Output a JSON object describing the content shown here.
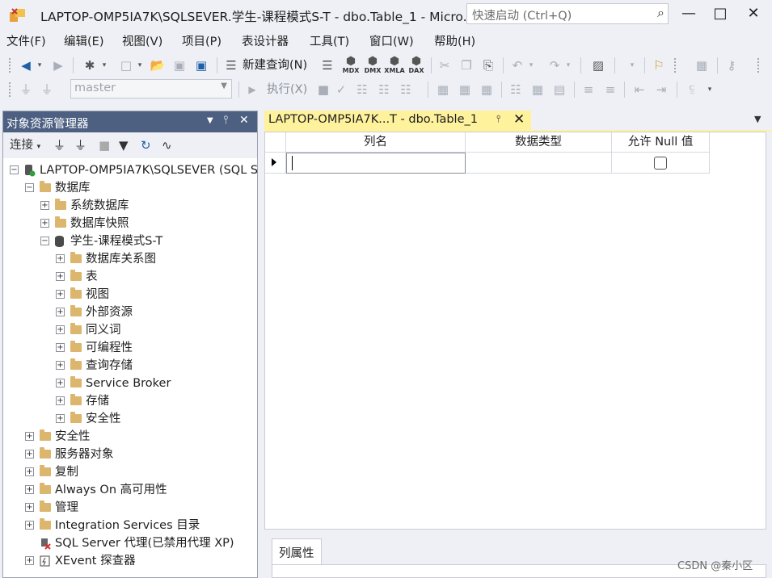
{
  "window": {
    "title": "LAPTOP-OMP5IA7K\\SQLSEVER.学生-课程模式S-T - dbo.Table_1 - Micro...",
    "quick_launch_placeholder": "快速启动 (Ctrl+Q)",
    "minimize": "—",
    "maximize": "□",
    "close": "✕"
  },
  "menu": [
    "文件(F)",
    "编辑(E)",
    "视图(V)",
    "项目(P)",
    "表设计器",
    "工具(T)",
    "窗口(W)",
    "帮助(H)"
  ],
  "toolbar1": {
    "new_query_label": "新建查询(N)",
    "mini_labels": [
      "MDX",
      "DMX",
      "XMLA",
      "DAX"
    ]
  },
  "toolbar2": {
    "database": "master",
    "execute_label": "执行(X)"
  },
  "object_explorer": {
    "title": "对象资源管理器",
    "connect_label": "连接",
    "tree": [
      {
        "label": "LAPTOP-OMP5IA7K\\SQLSEVER (SQL S",
        "level": 0,
        "icon": "server-icon",
        "expander": "⊟"
      },
      {
        "label": "数据库",
        "level": 1,
        "icon": "folder-icon",
        "expander": "⊟"
      },
      {
        "label": "系统数据库",
        "level": 2,
        "icon": "folder-icon",
        "expander": "⊞"
      },
      {
        "label": "数据库快照",
        "level": 2,
        "icon": "folder-icon",
        "expander": "⊞"
      },
      {
        "label": "学生-课程模式S-T",
        "level": 2,
        "icon": "database-icon",
        "expander": "⊟"
      },
      {
        "label": "数据库关系图",
        "level": 3,
        "icon": "folder-icon",
        "expander": "⊞"
      },
      {
        "label": "表",
        "level": 3,
        "icon": "folder-icon",
        "expander": "⊞"
      },
      {
        "label": "视图",
        "level": 3,
        "icon": "folder-icon",
        "expander": "⊞"
      },
      {
        "label": "外部资源",
        "level": 3,
        "icon": "folder-icon",
        "expander": "⊞"
      },
      {
        "label": "同义词",
        "level": 3,
        "icon": "folder-icon",
        "expander": "⊞"
      },
      {
        "label": "可编程性",
        "level": 3,
        "icon": "folder-icon",
        "expander": "⊞"
      },
      {
        "label": "查询存储",
        "level": 3,
        "icon": "folder-icon",
        "expander": "⊞"
      },
      {
        "label": "Service Broker",
        "level": 3,
        "icon": "folder-icon",
        "expander": "⊞"
      },
      {
        "label": "存储",
        "level": 3,
        "icon": "folder-icon",
        "expander": "⊞"
      },
      {
        "label": "安全性",
        "level": 3,
        "icon": "folder-icon",
        "expander": "⊞"
      },
      {
        "label": "安全性",
        "level": 1,
        "icon": "folder-icon",
        "expander": "⊞"
      },
      {
        "label": "服务器对象",
        "level": 1,
        "icon": "folder-icon",
        "expander": "⊞"
      },
      {
        "label": "复制",
        "level": 1,
        "icon": "folder-icon",
        "expander": "⊞"
      },
      {
        "label": "Always On 高可用性",
        "level": 1,
        "icon": "folder-icon",
        "expander": "⊞"
      },
      {
        "label": "管理",
        "level": 1,
        "icon": "folder-icon",
        "expander": "⊞"
      },
      {
        "label": "Integration Services 目录",
        "level": 1,
        "icon": "folder-icon",
        "expander": "⊞"
      },
      {
        "label": "SQL Server 代理(已禁用代理 XP)",
        "level": 1,
        "icon": "agent-icon",
        "expander": ""
      },
      {
        "label": "XEvent 探查器",
        "level": 1,
        "icon": "xevent-icon",
        "expander": "⊞"
      }
    ]
  },
  "document_tab": {
    "title": "LAPTOP-OMP5IA7K...T - dbo.Table_1"
  },
  "designer": {
    "columns": [
      "列名",
      "数据类型",
      "允许 Null 值"
    ],
    "rows": [
      {
        "name": "",
        "type": "",
        "allow_null": false
      }
    ]
  },
  "properties": {
    "tab_label": "列属性"
  },
  "watermark": "CSDN @秦小区"
}
